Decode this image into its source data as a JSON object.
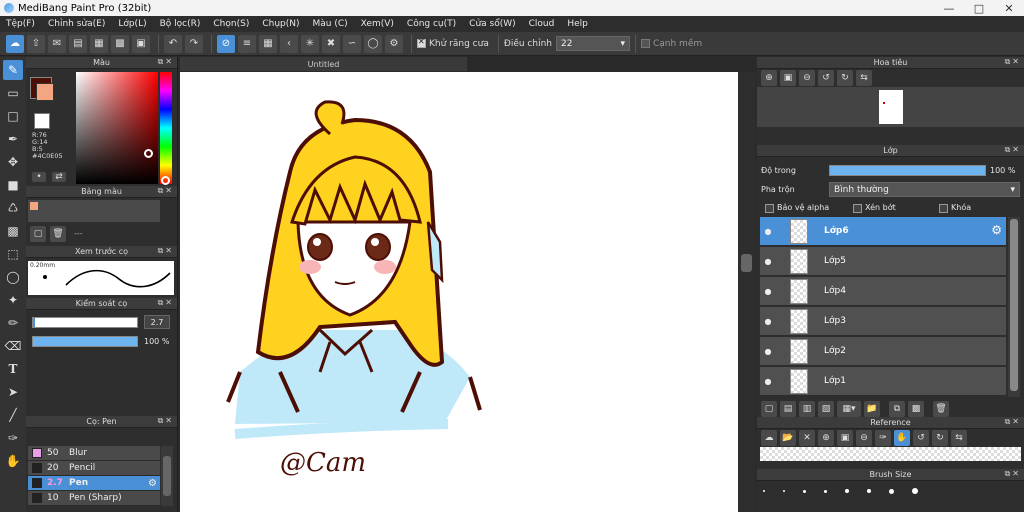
{
  "window": {
    "title": "MediBang Paint Pro (32bit)"
  },
  "menu": [
    "Tệp(F)",
    "Chỉnh sửa(E)",
    "Lớp(L)",
    "Bộ lọc(R)",
    "Chọn(S)",
    "Chụp(N)",
    "Màu (C)",
    "Xem(V)",
    "Công cụ(T)",
    "Cửa sổ(W)",
    "Cloud",
    "Help"
  ],
  "toolbar": {
    "antialias_label": "Khử răng cưa",
    "correction_label": "Điều chỉnh",
    "correction_value": "22",
    "edge_label": "Cạnh mềm"
  },
  "color_panel": {
    "title": "Màu",
    "rgb": {
      "r": "R:76",
      "g": "G:14",
      "b": "B:5"
    },
    "hex": "#4C0E05",
    "primary_color": "#4c0e05",
    "secondary_color": "#ffffff"
  },
  "palette_panel": {
    "title": "Bảng màu",
    "swatch": "#f4a582",
    "name": "---"
  },
  "preview_panel": {
    "title": "Xem trước cọ",
    "size_label": "0.20mm"
  },
  "control_panel": {
    "title": "Kiểm soát cọ",
    "size_value": "2.7",
    "opacity_value": "100 %",
    "opacity_fraction": 1.0
  },
  "brush_panel": {
    "title": "Cọ: Pen",
    "items": [
      {
        "size": "50",
        "name": "Blur",
        "color": "#e8a0e8"
      },
      {
        "size": "20",
        "name": "Pencil",
        "color": "#222222"
      },
      {
        "size": "2.7",
        "name": "Pen",
        "color": "#222222",
        "selected": true
      },
      {
        "size": "10",
        "name": "Pen (Sharp)",
        "color": "#222222"
      }
    ]
  },
  "document": {
    "tab": "Untitled",
    "signature": "@Cam"
  },
  "navigator_panel": {
    "title": "Hoa tiêu"
  },
  "layer_panel": {
    "title": "Lớp",
    "opacity_label": "Độ trong",
    "opacity_value": "100 %",
    "opacity_fraction": 1.0,
    "blend_label": "Pha trộn",
    "blend_value": "Bình thường",
    "protect_alpha_label": "Bảo vệ alpha",
    "clipping_label": "Xén bớt",
    "lock_label": "Khóa",
    "layers": [
      "Lớp6",
      "Lớp5",
      "Lớp4",
      "Lớp3",
      "Lớp2",
      "Lớp1"
    ]
  },
  "reference_panel": {
    "title": "Reference"
  },
  "brush_size_panel": {
    "title": "Brush Size"
  },
  "colors": {
    "accent": "#4a90d6",
    "hair": "#ffd21f",
    "outline": "#4c0e05",
    "shirt": "#b8e6f7"
  }
}
